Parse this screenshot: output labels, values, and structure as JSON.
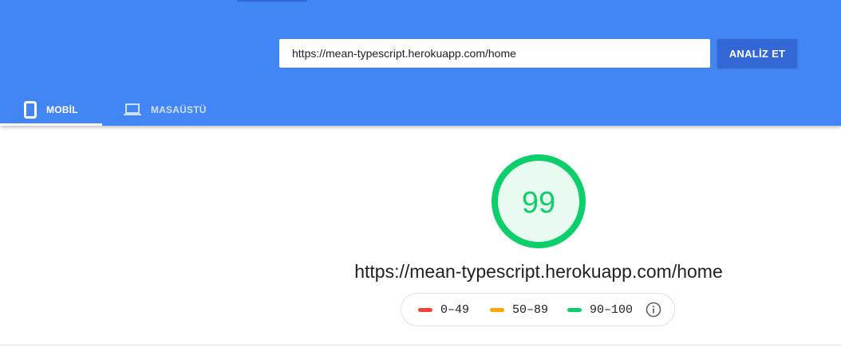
{
  "search": {
    "value": "https://mean-typescript.herokuapp.com/home",
    "button_label": "ANALİZ ET"
  },
  "tabs": [
    {
      "label": "MOBİL",
      "icon": "smartphone-icon",
      "active": true
    },
    {
      "label": "MASAÜSTÜ",
      "icon": "laptop-icon",
      "active": false
    }
  ],
  "score": {
    "value": "99",
    "url": "https://mean-typescript.herokuapp.com/home"
  },
  "legend": [
    {
      "range": "0–49",
      "color": "#f44336"
    },
    {
      "range": "50–89",
      "color": "#ffa400"
    },
    {
      "range": "90–100",
      "color": "#0cce6b"
    }
  ],
  "colors": {
    "header": "#4285f4",
    "button": "#3367d6",
    "score_green": "#0cce6b",
    "score_fill": "#e9faf0"
  }
}
